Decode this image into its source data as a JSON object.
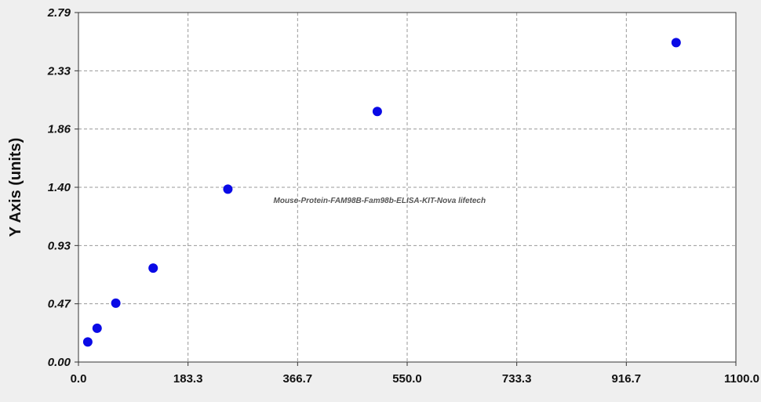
{
  "chart_data": {
    "type": "scatter",
    "title": "",
    "xlabel": "",
    "ylabel": "Y Axis (units)",
    "watermark": "Mouse-Protein-FAM98B-Fam98b-ELISA-KIT-Nova lifetech",
    "xlim": [
      0,
      1100
    ],
    "ylim": [
      0,
      2.79
    ],
    "x_ticks": [
      "0.0",
      "183.3",
      "366.7",
      "550.0",
      "733.3",
      "916.7",
      "1100.0"
    ],
    "y_ticks": [
      "0.00",
      "0.47",
      "0.93",
      "1.40",
      "1.86",
      "2.33",
      "2.79"
    ],
    "grid": true,
    "series": [
      {
        "x": [
          15.6,
          31.2,
          62.5,
          125,
          250,
          500,
          1000
        ],
        "y": [
          0.16,
          0.27,
          0.47,
          0.75,
          1.38,
          2.0,
          2.55
        ]
      }
    ],
    "colors": {
      "point": "#0a0ae6",
      "plot_bg": "#ffffff",
      "page_bg": "#efefef"
    }
  }
}
